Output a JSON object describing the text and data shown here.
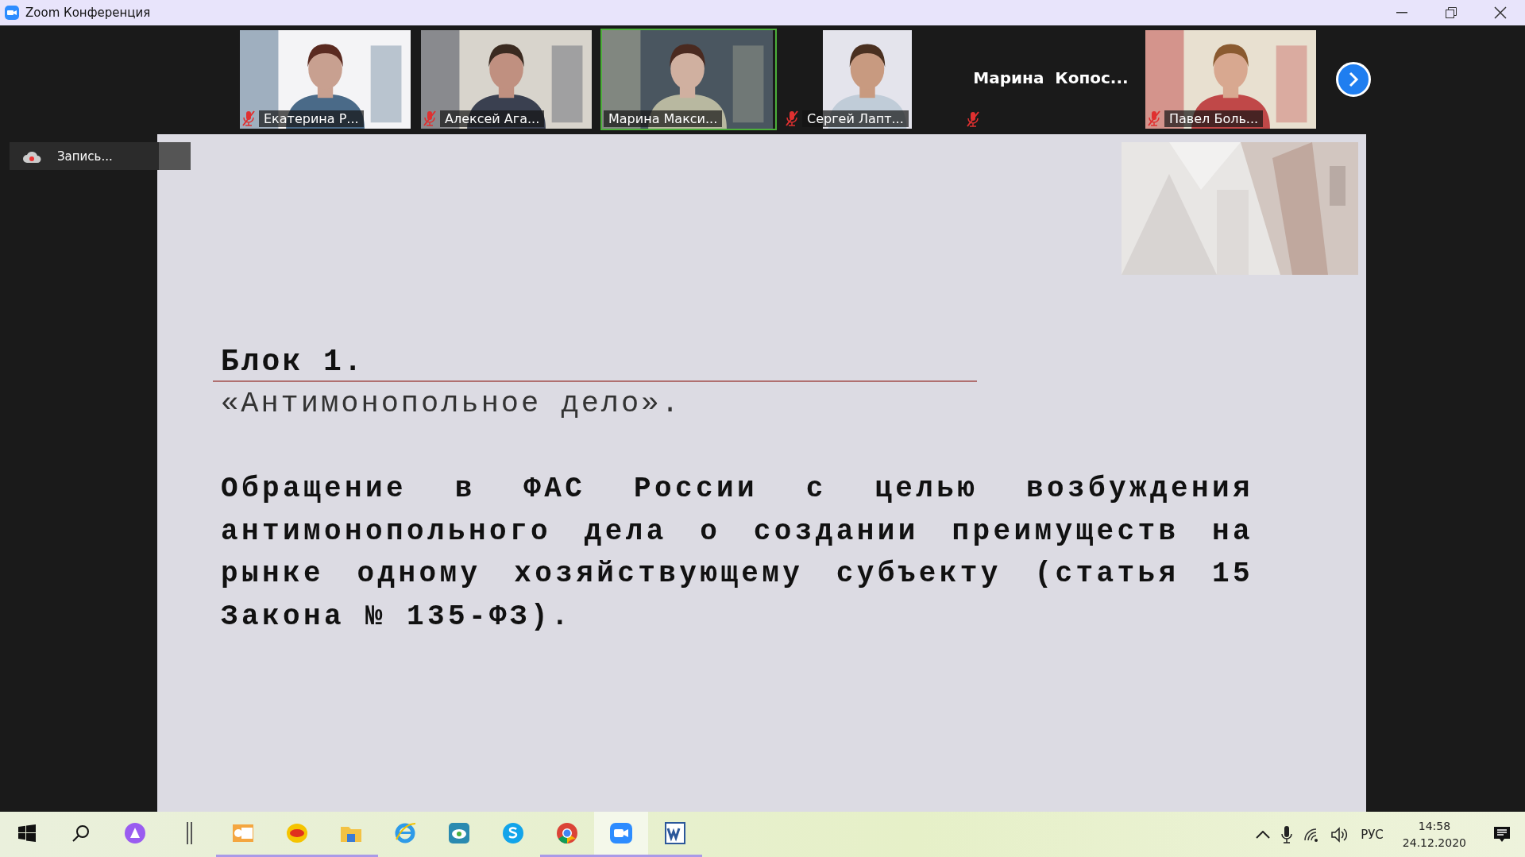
{
  "window": {
    "title": "Zoom Конференция"
  },
  "participants": [
    {
      "name": "Екатерина Р...",
      "muted": true,
      "selected": false,
      "kind": "video"
    },
    {
      "name": "Алексей Ага...",
      "muted": true,
      "selected": false,
      "kind": "video"
    },
    {
      "name": "Марина Макси...",
      "muted": false,
      "selected": true,
      "kind": "video"
    },
    {
      "name": "Сергей Лапт...",
      "muted": true,
      "selected": false,
      "kind": "video"
    },
    {
      "name": "Марина  Копос...",
      "muted": true,
      "selected": false,
      "kind": "no_video"
    },
    {
      "name": "Павел Боль...",
      "muted": true,
      "selected": false,
      "kind": "video"
    }
  ],
  "recording": {
    "label": "Запись..."
  },
  "slide": {
    "title": "Блок 1.",
    "subtitle": "«Антимонопольное дело».",
    "body": "Обращение в ФАС России с целью возбуждения антимонопольного дела о создании преимуществ на рынке одному хозяйствующему субъекту (статья 15 Закона № 135-ФЗ)."
  },
  "taskbar": {
    "apps": [
      {
        "kind": "alice",
        "running": false,
        "active": false
      },
      {
        "kind": "divider",
        "running": false,
        "active": false
      },
      {
        "kind": "outlook",
        "running": true,
        "active": false
      },
      {
        "kind": "onec",
        "running": true,
        "active": false
      },
      {
        "kind": "folder",
        "running": true,
        "active": false
      },
      {
        "kind": "ie",
        "running": false,
        "active": false
      },
      {
        "kind": "cloud",
        "running": false,
        "active": false
      },
      {
        "kind": "skype",
        "running": false,
        "active": false
      },
      {
        "kind": "chrome",
        "running": true,
        "active": false
      },
      {
        "kind": "zoom",
        "running": true,
        "active": true
      },
      {
        "kind": "word",
        "running": true,
        "active": false
      }
    ],
    "language": "РУС",
    "time": "14:58",
    "date": "24.12.2020"
  }
}
